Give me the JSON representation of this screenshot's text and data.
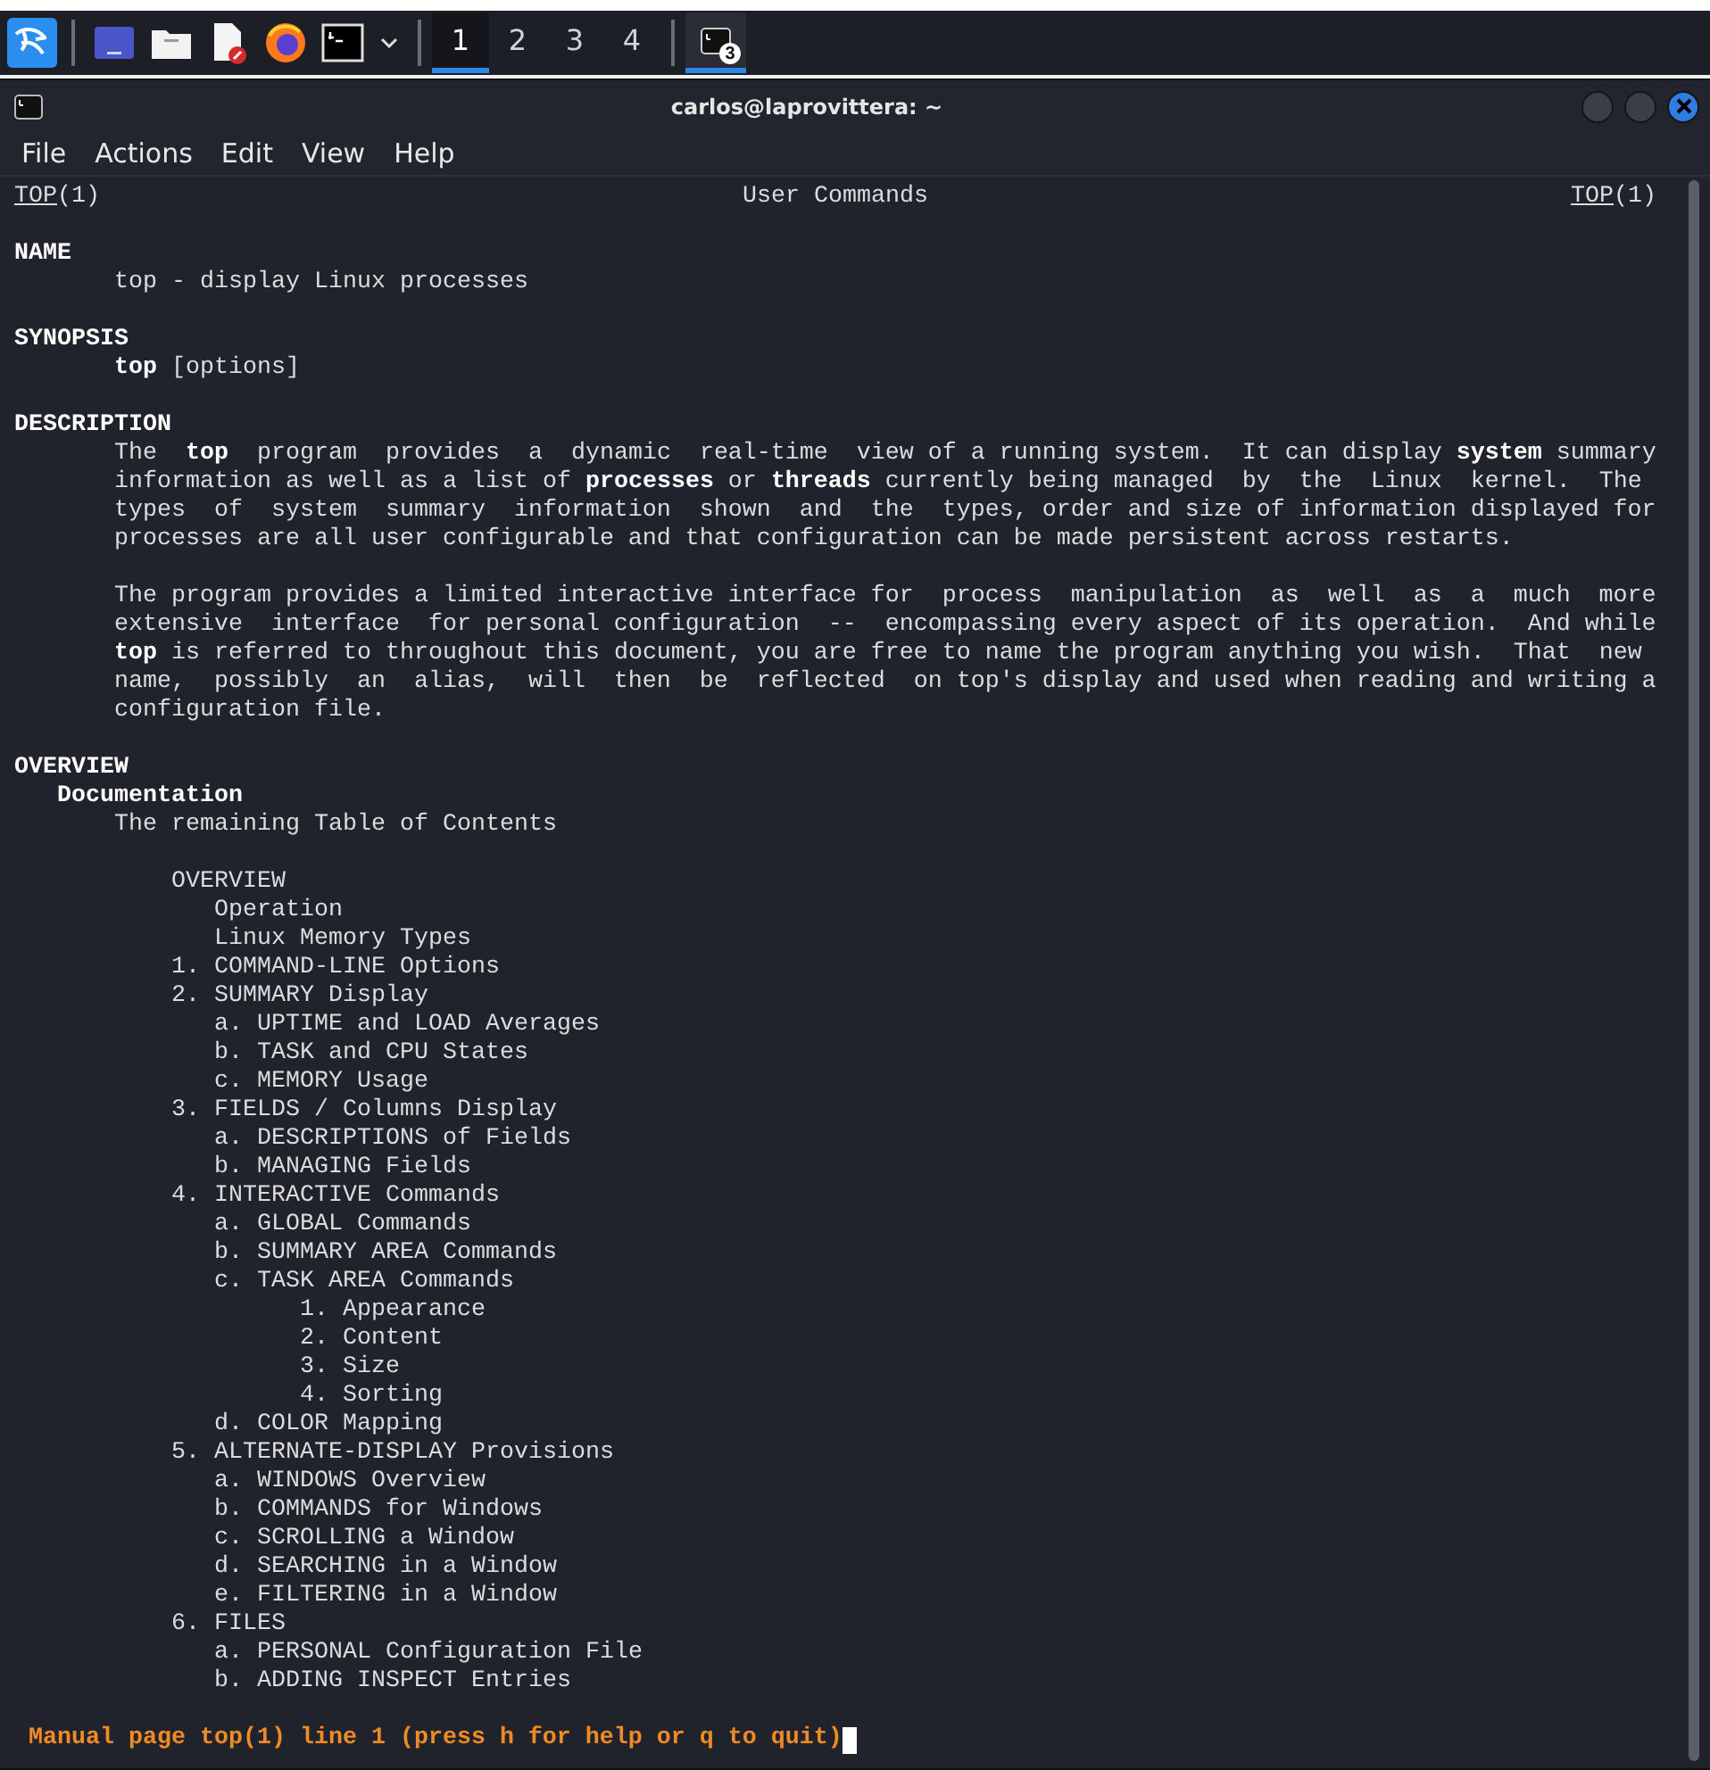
{
  "taskbar": {
    "launchers": [
      {
        "kind": "dragon"
      },
      {
        "kind": "screen"
      },
      {
        "kind": "folder"
      },
      {
        "kind": "editor"
      },
      {
        "kind": "browser"
      },
      {
        "kind": "terminal"
      }
    ],
    "workspaces": [
      {
        "label": "1",
        "selected": true
      },
      {
        "label": "2",
        "selected": false
      },
      {
        "label": "3",
        "selected": false
      },
      {
        "label": "4",
        "selected": false
      }
    ],
    "task": {
      "badge": "3",
      "selected": true
    }
  },
  "window": {
    "title": "carlos@laprovittera: ~",
    "menu": [
      "File",
      "Actions",
      "Edit",
      "View",
      "Help"
    ],
    "man": {
      "header": {
        "left": {
          "name": "TOP",
          "section": "(1)"
        },
        "center": "User Commands",
        "right": {
          "name": "TOP",
          "section": "(1)"
        }
      },
      "sections": [
        {
          "heading": "NAME",
          "paragraphs": [
            "top - display Linux processes"
          ]
        },
        {
          "heading": "SYNOPSIS",
          "paragraphs": [
            "**top** [options]"
          ]
        },
        {
          "heading": "DESCRIPTION",
          "paragraphs": [
            "The  **top**  program  provides  a  dynamic  real-time  view of a running system.  It can display **system** summary\ninformation as well as a list of **processes** or **threads** currently being managed  by  the  Linux  kernel.  The\ntypes  of  system  summary  information  shown  and  the  types, order and size of information displayed for\nprocesses are all user configurable and that configuration can be made persistent across restarts.",
            "The program provides a limited interactive interface for  process  manipulation  as  well  as  a  much  more\nextensive  interface  for personal configuration  --  encompassing every aspect of its operation.  And while\n**top** is referred to throughout this document, you are free to name the program anything you wish.  That  new\nname,  possibly  an  alias,  will  then  be  reflected  on top's display and used when reading and writing a\nconfiguration file."
          ]
        },
        {
          "heading": "OVERVIEW",
          "subheading": "Documentation",
          "paragraphs": [
            "The remaining Table of Contents"
          ],
          "toc": [
            {
              "label": "OVERVIEW",
              "children": [
                {
                  "label": "Operation"
                },
                {
                  "label": "Linux Memory Types"
                }
              ]
            },
            {
              "label": "1. COMMAND-LINE Options"
            },
            {
              "label": "2. SUMMARY Display",
              "children": [
                {
                  "label": "a. UPTIME and LOAD Averages"
                },
                {
                  "label": "b. TASK and CPU States"
                },
                {
                  "label": "c. MEMORY Usage"
                }
              ]
            },
            {
              "label": "3. FIELDS / Columns Display",
              "children": [
                {
                  "label": "a. DESCRIPTIONS of Fields"
                },
                {
                  "label": "b. MANAGING Fields"
                }
              ]
            },
            {
              "label": "4. INTERACTIVE Commands",
              "children": [
                {
                  "label": "a. GLOBAL Commands"
                },
                {
                  "label": "b. SUMMARY AREA Commands"
                },
                {
                  "label": "c. TASK AREA Commands",
                  "children": [
                    {
                      "label": "1. Appearance"
                    },
                    {
                      "label": "2. Content"
                    },
                    {
                      "label": "3. Size"
                    },
                    {
                      "label": "4. Sorting"
                    }
                  ]
                },
                {
                  "label": "d. COLOR Mapping"
                }
              ]
            },
            {
              "label": "5. ALTERNATE-DISPLAY Provisions",
              "children": [
                {
                  "label": "a. WINDOWS Overview"
                },
                {
                  "label": "b. COMMANDS for Windows"
                },
                {
                  "label": "c. SCROLLING a Window"
                },
                {
                  "label": "d. SEARCHING in a Window"
                },
                {
                  "label": "e. FILTERING in a Window"
                }
              ]
            },
            {
              "label": "6. FILES",
              "children": [
                {
                  "label": "a. PERSONAL Configuration File"
                },
                {
                  "label": "b. ADDING INSPECT Entries"
                }
              ]
            }
          ]
        }
      ],
      "status": "Manual page top(1) line 1 (press h for help or q to quit)"
    }
  }
}
